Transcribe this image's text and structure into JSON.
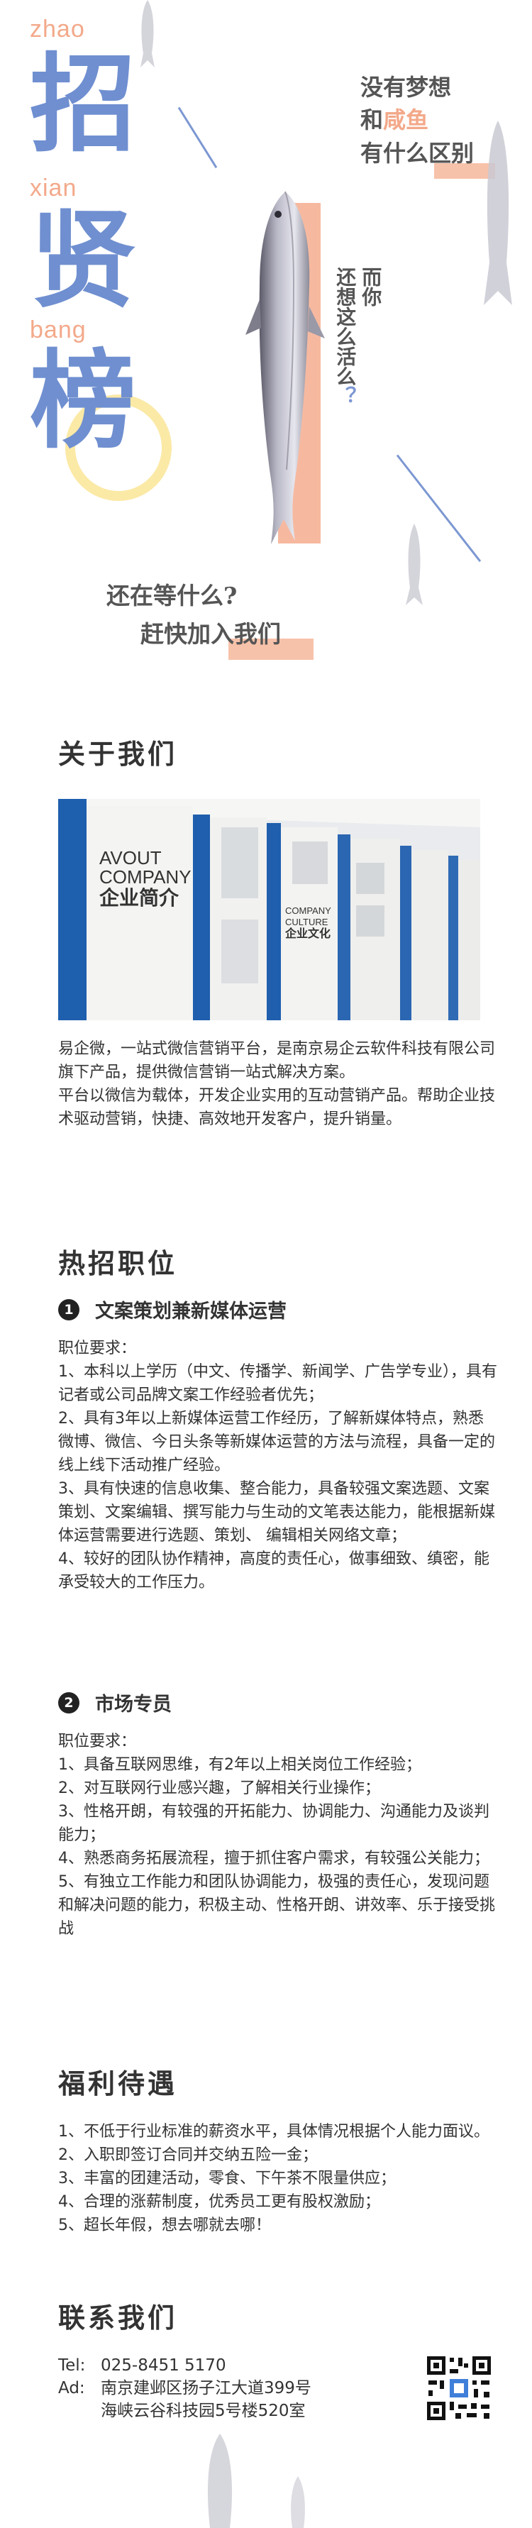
{
  "hero": {
    "pinyin_1": "zhao",
    "pinyin_2": "xian",
    "pinyin_3": "bang",
    "char_1": "招",
    "char_2": "贤",
    "char_3": "榜",
    "slogan_line1": "没有梦想",
    "slogan_line2_a": "和",
    "slogan_line2_b": "咸鱼",
    "slogan_line3": "有什么区别",
    "vertical_1": "还想这么活么",
    "vertical_2": "而你",
    "vertical_q": "？",
    "cta_line1": "还在等什么?",
    "cta_line2": "赶快加入我们"
  },
  "about": {
    "title": "关于我们",
    "photo_alt_text_1": "AVOUT",
    "photo_alt_text_2": "COMPANY",
    "photo_alt_text_3": "企业简介",
    "photo_alt_text_4": "COMPANY",
    "photo_alt_text_5": "CULTURE",
    "photo_alt_text_6": "企业文化",
    "para1": "易企微，一站式微信营销平台，是南京易企云软件科技有限公司旗下产品，提供微信营销一站式解决方案。",
    "para2": "平台以微信为载体，开发企业实用的互动营销产品。帮助企业技术驱动营销，快捷、高效地开发客户，提升销量。"
  },
  "jobs": {
    "title": "热招职位",
    "job1": {
      "num": "1",
      "name": "文案策划兼新媒体运营",
      "req_label": "职位要求：",
      "items": [
        "1、本科以上学历（中文、传播学、新闻学、广告学专业），具有记者或公司品牌文案工作经验者优先；",
        "2、具有3年以上新媒体运营工作经历，了解新媒体特点，熟悉微博、微信、今日头条等新媒体运营的方法与流程，具备一定的线上线下活动推广经验。",
        "3、具有快速的信息收集、整合能力，具备较强文案选题、文案策划、文案编辑、撰写能力与生动的文笔表达能力，能根据新媒体运营需要进行选题、策划、 编辑相关网络文章；",
        "4、较好的团队协作精神，高度的责任心，做事细致、缜密，能承受较大的工作压力。"
      ]
    },
    "job2": {
      "num": "2",
      "name": "市场专员",
      "req_label": "职位要求：",
      "items": [
        "1、具备互联网思维，有2年以上相关岗位工作经验；",
        "2、对互联网行业感兴趣，了解相关行业操作；",
        "3、性格开朗，有较强的开拓能力、协调能力、沟通能力及谈判能力；",
        "4、熟悉商务拓展流程，擅于抓住客户需求，有较强公关能力；",
        "5、有独立工作能力和团队协调能力，极强的责任心，发现问题和解决问题的能力，积极主动、性格开朗、讲效率、乐于接受挑战"
      ]
    }
  },
  "benefits": {
    "title": "福利待遇",
    "items": [
      "1、不低于行业标准的薪资水平，具体情况根据个人能力面议。",
      "2、入职即签订合同并交纳五险一金；",
      "3、丰富的团建活动，零食、下午茶不限量供应；",
      "4、合理的涨薪制度，优秀员工更有股权激励；",
      "5、超长年假，想去哪就去哪！"
    ]
  },
  "contact": {
    "title": "联系我们",
    "tel_label": "Tel:",
    "tel": "025-8451 5170",
    "ad_label": "Ad:",
    "address_line1": "南京建邺区扬子江大道399号",
    "address_line2": "海峡云谷科技园5号楼520室"
  },
  "colors": {
    "blue": "#6f8fd0",
    "peach": "#f3a98a",
    "yellow": "#fbe09a"
  }
}
